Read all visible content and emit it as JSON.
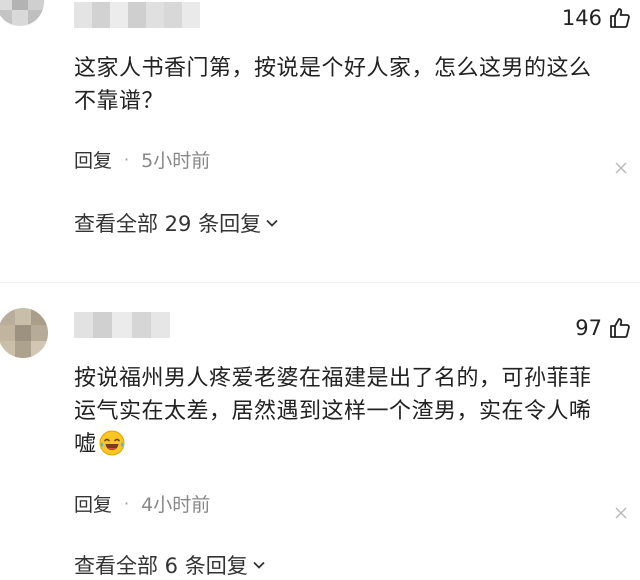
{
  "comments": [
    {
      "likes": "146",
      "text_lines": [
        "这家人书香门第，按说是个好人家，怎么这男的这么",
        "不靠谱？"
      ],
      "reply_label": "回复",
      "separator": "·",
      "time": "5小时前",
      "view_replies": "查看全部 29 条回复"
    },
    {
      "likes": "97",
      "text_lines": [
        "按说福州男人疼爱老婆在福建是出了名的，可孙菲菲",
        "运气实在太差，居然遇到这样一个渣男，实在令人唏",
        "嘘"
      ],
      "emoji_icon": "laugh-cry-emoji",
      "reply_label": "回复",
      "separator": "·",
      "time": "4小时前",
      "view_replies": "查看全部 6 条回复"
    }
  ],
  "colors": {
    "text": "#222222",
    "secondary": "#888888",
    "background": "#ffffff"
  },
  "icons": {
    "like": "thumbs-up-icon",
    "close": "close-icon",
    "expand": "chevron-down-icon"
  }
}
